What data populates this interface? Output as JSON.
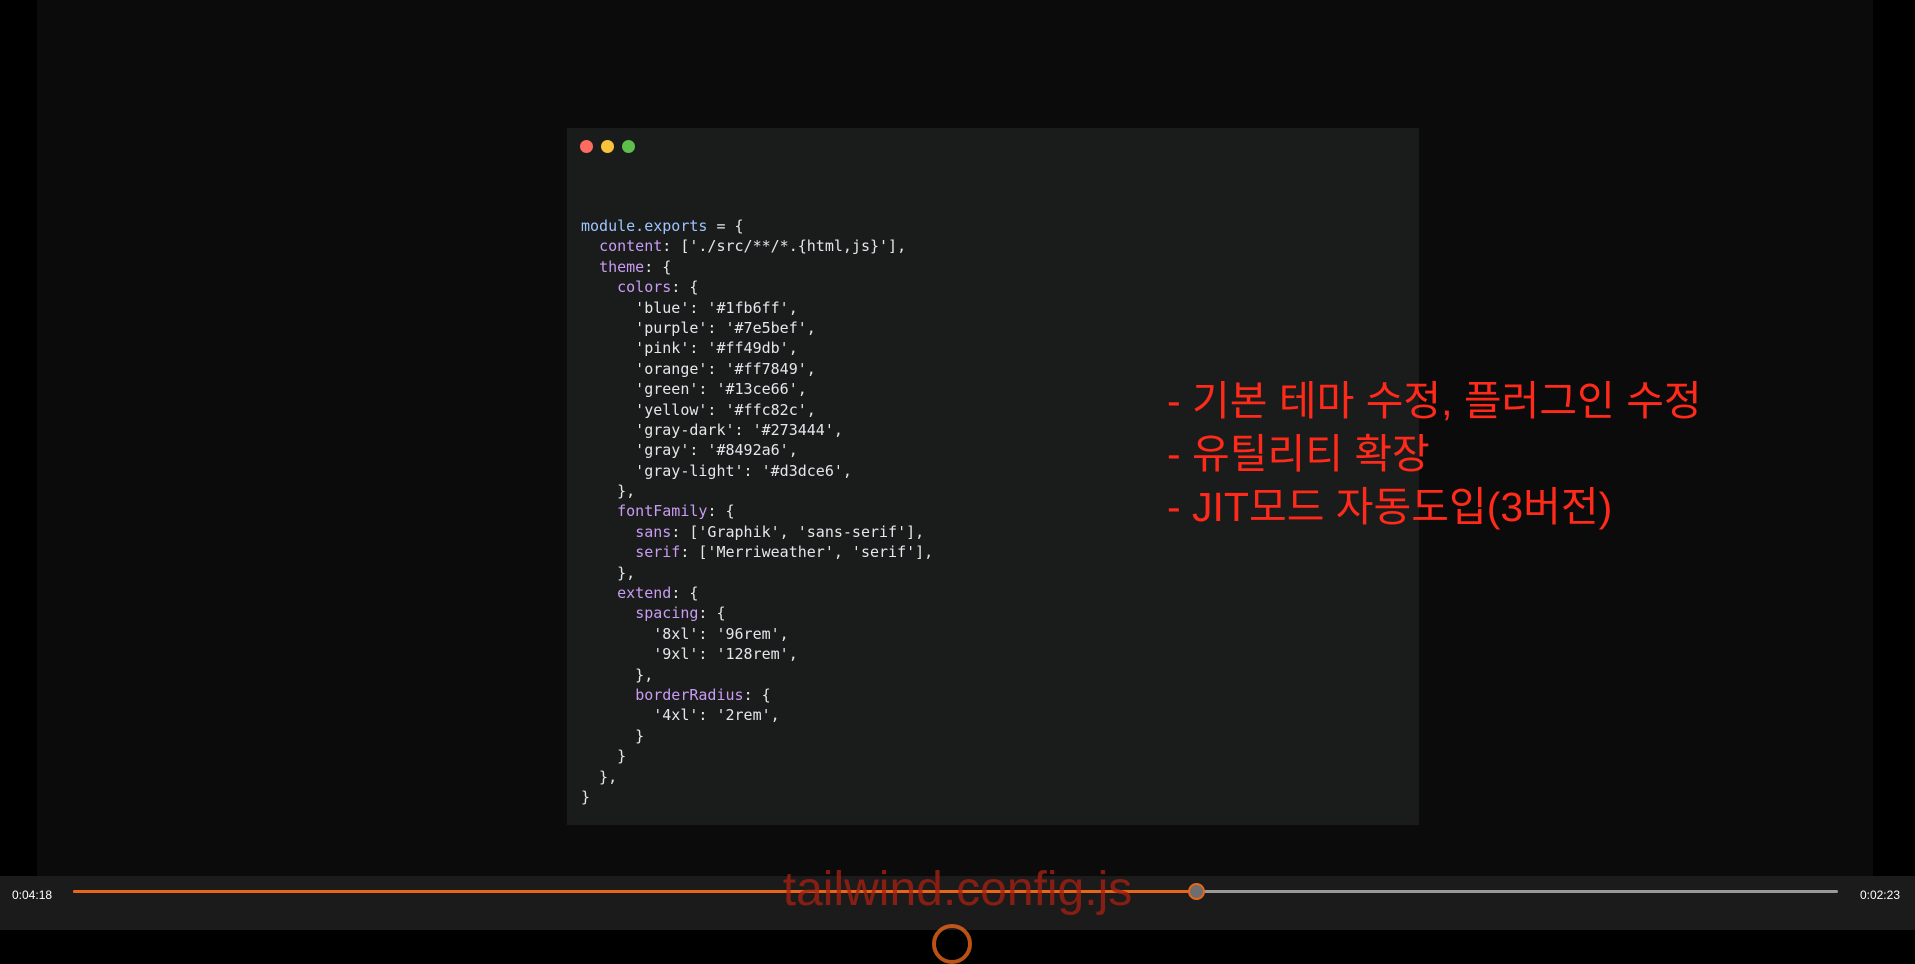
{
  "player": {
    "current_time": "0:04:18",
    "total_time": "0:02:23",
    "progress_fraction": 0.6364,
    "accent_color": "#e8661a"
  },
  "slide": {
    "code_lines": [
      [
        [
          "k",
          "module.exports"
        ],
        [
          "s",
          " = {"
        ]
      ],
      [
        [
          "s",
          "  "
        ],
        [
          "p",
          "content"
        ],
        [
          "s",
          ": ['./src/**/*.{html,js}'],"
        ]
      ],
      [
        [
          "s",
          "  "
        ],
        [
          "p",
          "theme"
        ],
        [
          "s",
          ": {"
        ]
      ],
      [
        [
          "s",
          "    "
        ],
        [
          "p",
          "colors"
        ],
        [
          "s",
          ": {"
        ]
      ],
      [
        [
          "s",
          "      'blue': '#1fb6ff',"
        ]
      ],
      [
        [
          "s",
          "      'purple': '#7e5bef',"
        ]
      ],
      [
        [
          "s",
          "      'pink': '#ff49db',"
        ]
      ],
      [
        [
          "s",
          "      'orange': '#ff7849',"
        ]
      ],
      [
        [
          "s",
          "      'green': '#13ce66',"
        ]
      ],
      [
        [
          "s",
          "      'yellow': '#ffc82c',"
        ]
      ],
      [
        [
          "s",
          "      'gray-dark': '#273444',"
        ]
      ],
      [
        [
          "s",
          "      'gray': '#8492a6',"
        ]
      ],
      [
        [
          "s",
          "      'gray-light': '#d3dce6',"
        ]
      ],
      [
        [
          "s",
          "    },"
        ]
      ],
      [
        [
          "s",
          "    "
        ],
        [
          "p",
          "fontFamily"
        ],
        [
          "s",
          ": {"
        ]
      ],
      [
        [
          "s",
          "      "
        ],
        [
          "p",
          "sans"
        ],
        [
          "s",
          ": ['Graphik', 'sans-serif'],"
        ]
      ],
      [
        [
          "s",
          "      "
        ],
        [
          "p",
          "serif"
        ],
        [
          "s",
          ": ['Merriweather', 'serif'],"
        ]
      ],
      [
        [
          "s",
          "    },"
        ]
      ],
      [
        [
          "s",
          "    "
        ],
        [
          "p",
          "extend"
        ],
        [
          "s",
          ": {"
        ]
      ],
      [
        [
          "s",
          "      "
        ],
        [
          "p",
          "spacing"
        ],
        [
          "s",
          ": {"
        ]
      ],
      [
        [
          "s",
          "        '8xl': '96rem',"
        ]
      ],
      [
        [
          "s",
          "        '9xl': '128rem',"
        ]
      ],
      [
        [
          "s",
          "      },"
        ]
      ],
      [
        [
          "s",
          "      "
        ],
        [
          "p",
          "borderRadius"
        ],
        [
          "s",
          ": {"
        ]
      ],
      [
        [
          "s",
          "        '4xl': '2rem',"
        ]
      ],
      [
        [
          "s",
          "      }"
        ]
      ],
      [
        [
          "s",
          "    }"
        ]
      ],
      [
        [
          "s",
          "  },"
        ]
      ],
      [
        [
          "s",
          "}"
        ]
      ]
    ],
    "notes": [
      "- 기본 테마 수정, 플러그인 수정",
      "- 유틸리티 확장",
      "- JIT모드 자동도입(3버전)"
    ],
    "caption": "tailwind.config.js"
  }
}
